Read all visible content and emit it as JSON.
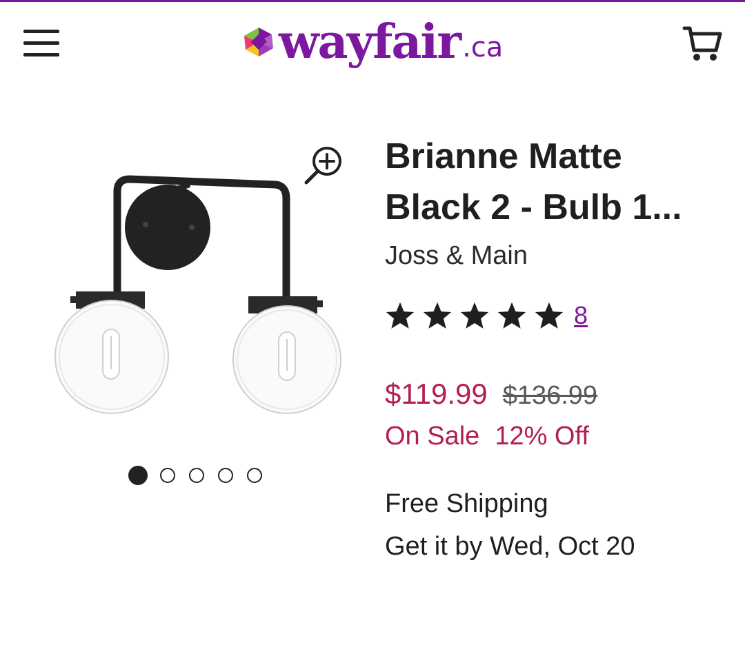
{
  "brand_colors": {
    "accent": "#7b189f",
    "sale": "#b31e55",
    "text": "#1f1f1f"
  },
  "header": {
    "menu_icon": "hamburger-menu-icon",
    "logo_text": "wayfair",
    "logo_suffix": ".ca",
    "cart_icon": "shopping-cart-icon"
  },
  "gallery": {
    "zoom_icon": "zoom-in-icon",
    "image_count": 5,
    "active_index": 0
  },
  "product": {
    "title_line1": "Brianne Matte",
    "title_line2": "Black 2 - Bulb 1...",
    "brand": "Joss & Main",
    "rating": 5,
    "review_count": "8",
    "price": "$119.99",
    "original_price": "$136.99",
    "sale_label": "On Sale",
    "discount": "12% Off",
    "shipping": "Free Shipping",
    "delivery": "Get it by Wed, Oct 20"
  }
}
